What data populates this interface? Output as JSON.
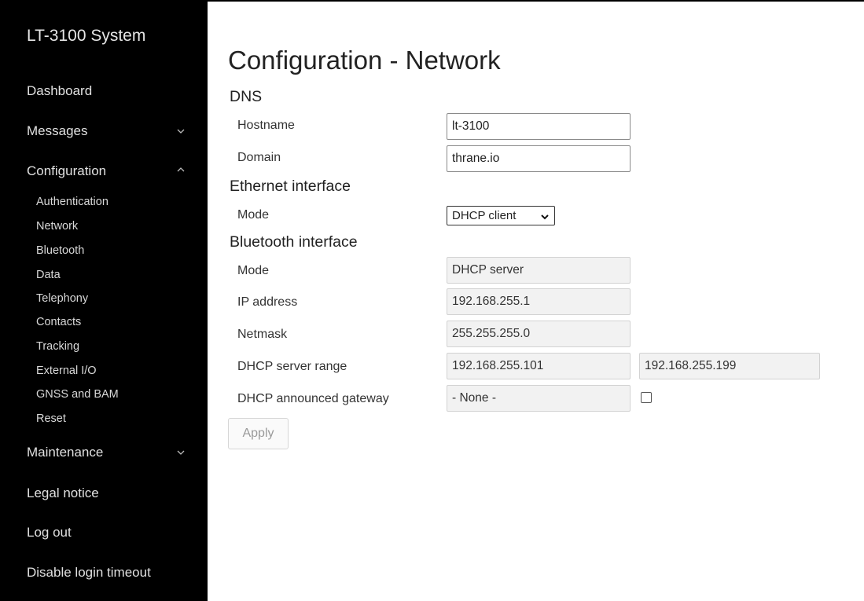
{
  "sidebar": {
    "brand": "LT-3100 System",
    "items": [
      {
        "label": "Dashboard"
      },
      {
        "label": "Messages",
        "chevron": "chevron-down-icon"
      },
      {
        "label": "Configuration",
        "chevron": "chevron-up-icon"
      },
      {
        "label": "Maintenance",
        "chevron": "chevron-down-icon"
      },
      {
        "label": "Legal notice"
      },
      {
        "label": "Log out"
      },
      {
        "label": "Disable login timeout"
      }
    ],
    "config_subitems": [
      {
        "label": "Authentication"
      },
      {
        "label": "Network"
      },
      {
        "label": "Bluetooth"
      },
      {
        "label": "Data"
      },
      {
        "label": "Telephony"
      },
      {
        "label": "Contacts"
      },
      {
        "label": "Tracking"
      },
      {
        "label": "External I/O"
      },
      {
        "label": "GNSS and BAM"
      },
      {
        "label": "Reset"
      }
    ]
  },
  "main": {
    "title": "Configuration - Network",
    "dns": {
      "heading": "DNS",
      "hostname_label": "Hostname",
      "hostname_value": "lt-3100",
      "domain_label": "Domain",
      "domain_value": "thrane.io"
    },
    "ethernet": {
      "heading": "Ethernet interface",
      "mode_label": "Mode",
      "mode_value": "DHCP client"
    },
    "bluetooth": {
      "heading": "Bluetooth interface",
      "mode_label": "Mode",
      "mode_value": "DHCP server",
      "ip_label": "IP address",
      "ip_value": "192.168.255.1",
      "netmask_label": "Netmask",
      "netmask_value": "255.255.255.0",
      "range_label": "DHCP server range",
      "range_start": "192.168.255.101",
      "range_end": "192.168.255.199",
      "gateway_label": "DHCP announced gateway",
      "gateway_value": "- None -",
      "gateway_checked": false
    },
    "apply_label": "Apply"
  },
  "colors": {
    "sidebar_bg": "#000000",
    "sidebar_text": "#e0e0e0",
    "readonly_bg": "#f2f2f2",
    "disabled_text": "#9a9a9a"
  }
}
